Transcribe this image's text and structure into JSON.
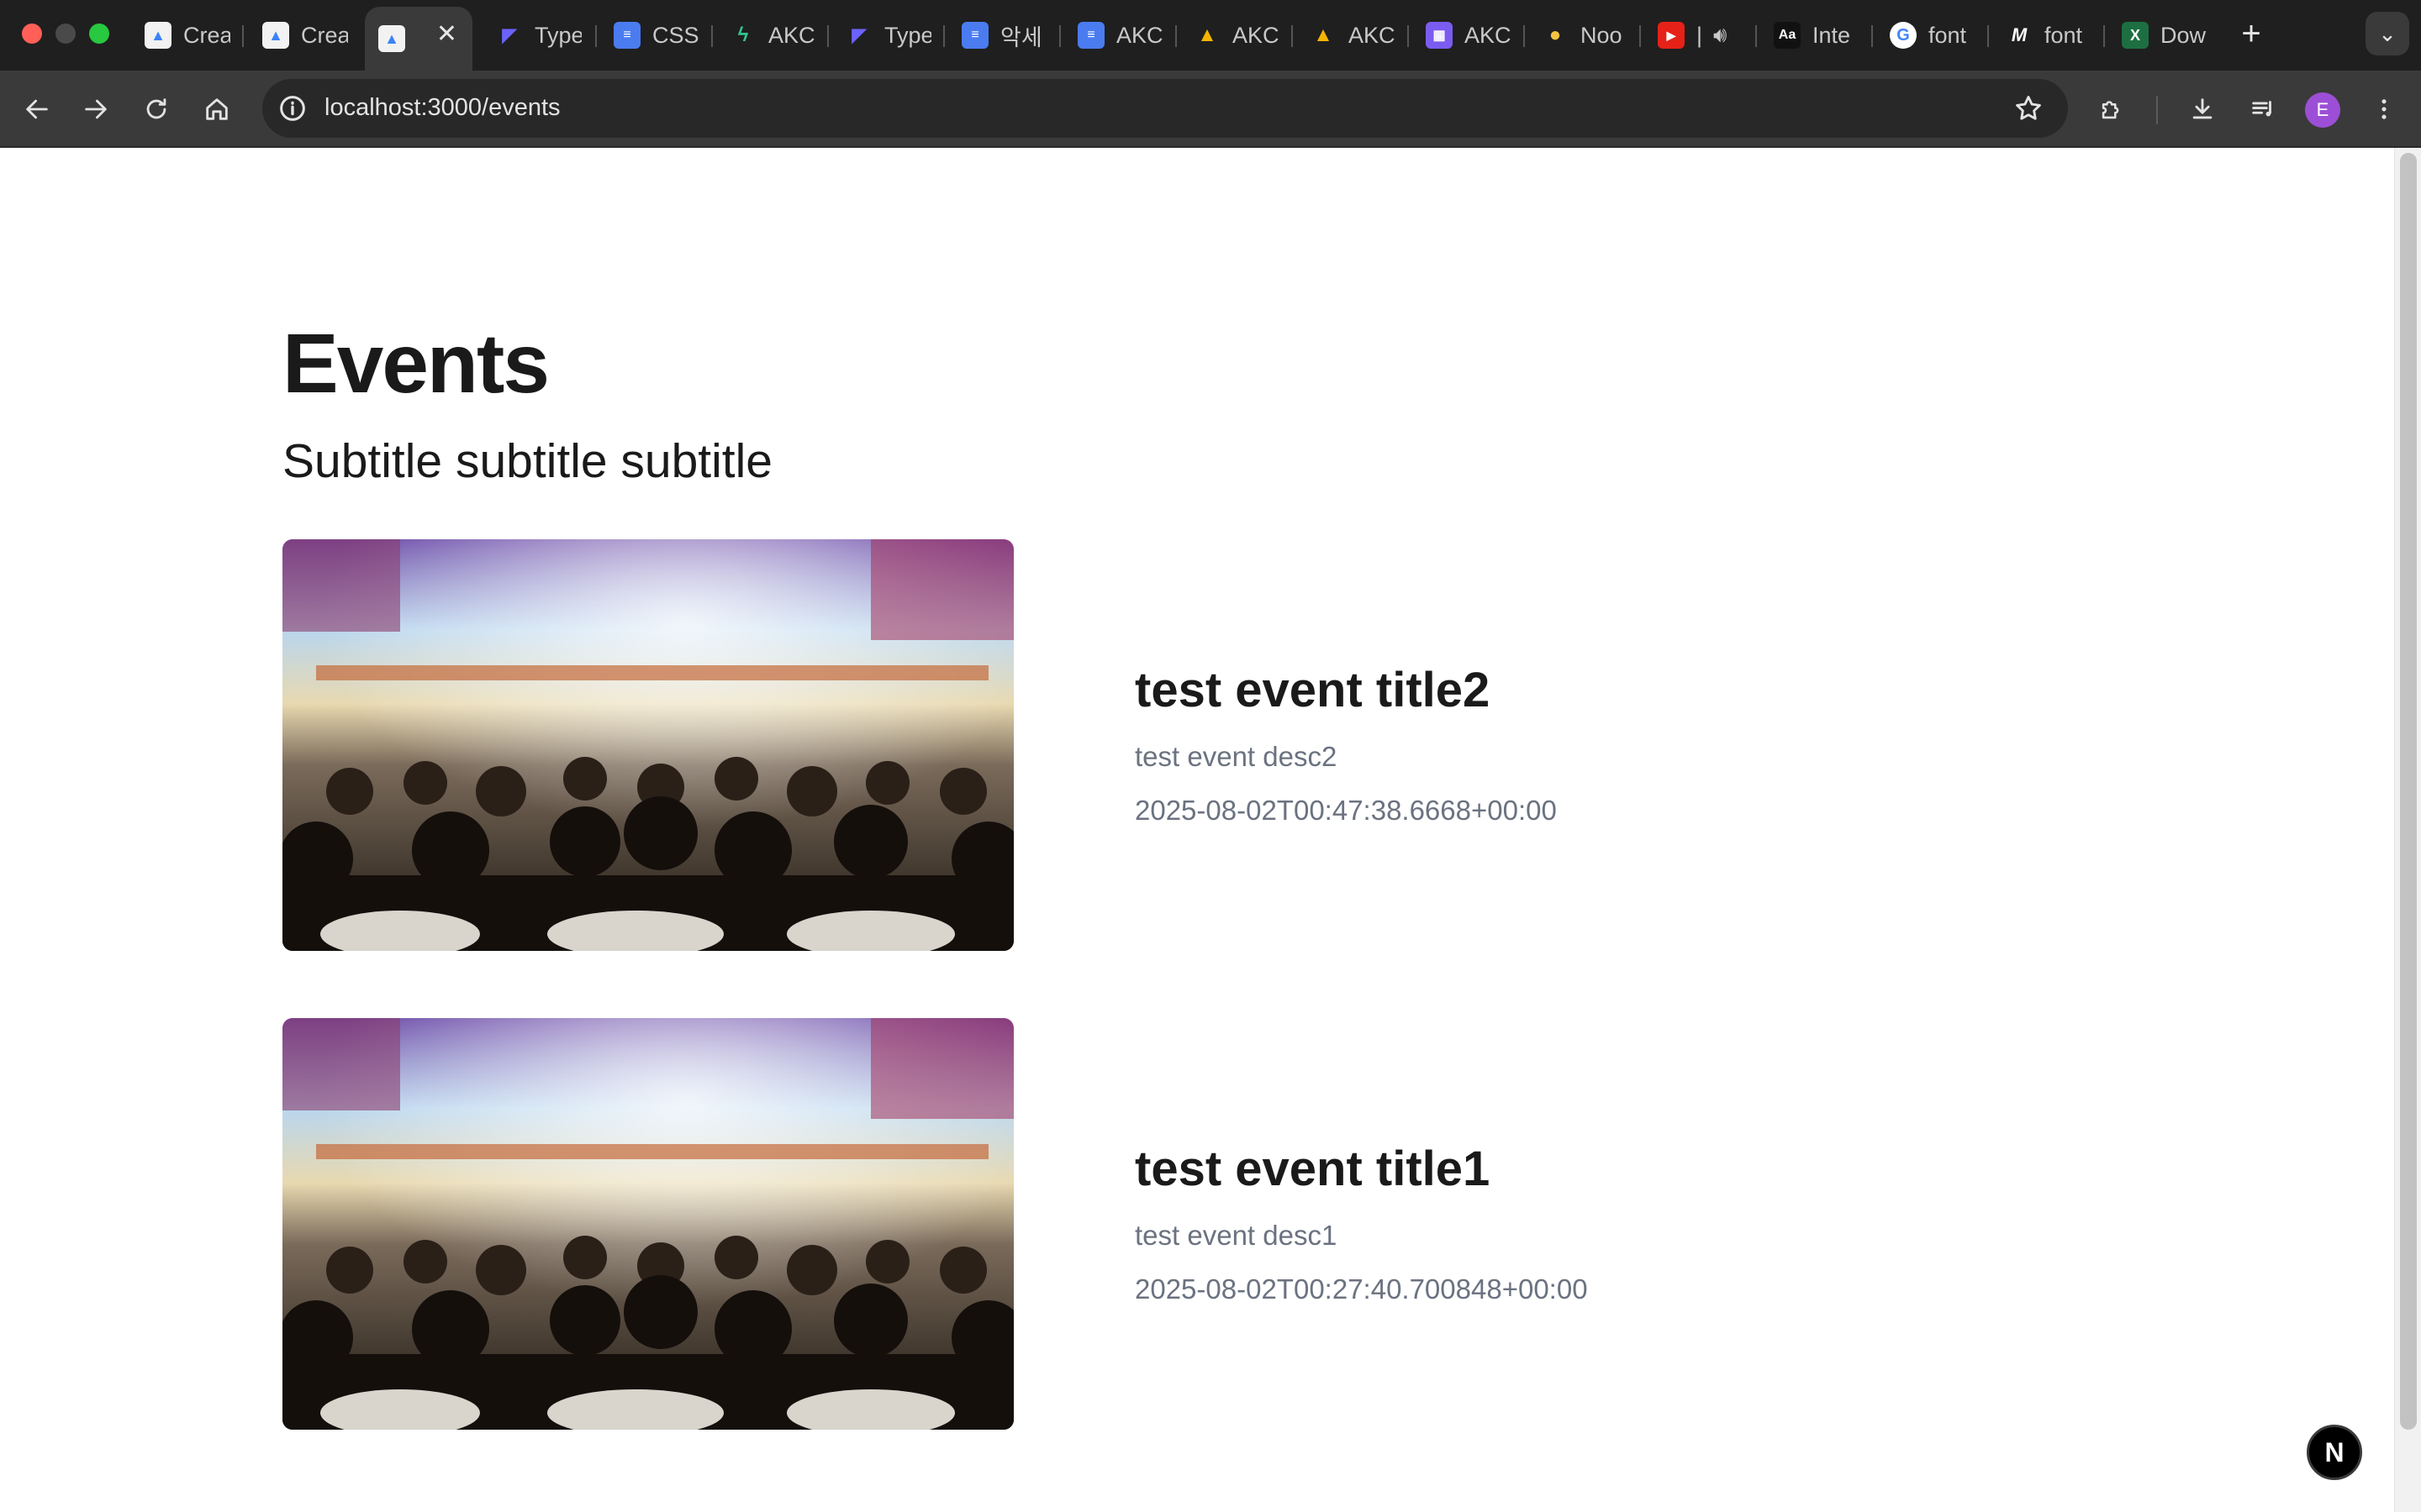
{
  "browser": {
    "tabs": [
      {
        "label": "Crea",
        "icon": "app-icon"
      },
      {
        "label": "Crea",
        "icon": "app-icon"
      },
      {
        "label": "",
        "icon": "app-icon",
        "active": true
      },
      {
        "label": "Type",
        "icon": "typeform-icon"
      },
      {
        "label": "CSS",
        "icon": "docs-icon"
      },
      {
        "label": "AKC",
        "icon": "bolt-icon"
      },
      {
        "label": "Type",
        "icon": "typeform-icon"
      },
      {
        "label": "악세",
        "icon": "docs-icon"
      },
      {
        "label": "AKC",
        "icon": "docs-icon"
      },
      {
        "label": "AKC",
        "icon": "drive-icon"
      },
      {
        "label": "AKC",
        "icon": "drive-icon"
      },
      {
        "label": "AKC",
        "icon": "calendar-icon"
      },
      {
        "label": "Noo",
        "icon": "duck-icon"
      },
      {
        "label": "|",
        "icon": "youtube-icon"
      },
      {
        "label": "Inte",
        "icon": "font-icon"
      },
      {
        "label": "font",
        "icon": "google-icon"
      },
      {
        "label": "font",
        "icon": "medium-icon"
      },
      {
        "label": "Dow",
        "icon": "excel-icon"
      }
    ],
    "url": "localhost:3000/events",
    "avatar_letter": "E"
  },
  "page": {
    "title": "Events",
    "subtitle": "Subtitle subtitle subtitle"
  },
  "events": [
    {
      "title": "test event title2",
      "desc": "test event desc2",
      "date": "2025-08-02T00:47:38.6668+00:00"
    },
    {
      "title": "test event title1",
      "desc": "test event desc1",
      "date": "2025-08-02T00:27:40.700848+00:00"
    }
  ],
  "devtools": {
    "badge": "N"
  }
}
